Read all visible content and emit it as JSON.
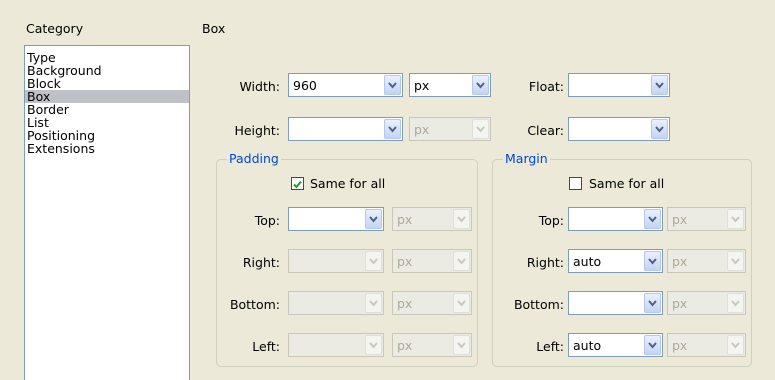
{
  "headers": {
    "category": "Category",
    "box": "Box"
  },
  "categories": [
    "Type",
    "Background",
    "Block",
    "Box",
    "Border",
    "List",
    "Positioning",
    "Extensions"
  ],
  "selected_category": "Box",
  "width": {
    "label": "Width:",
    "value": "960",
    "unit": "px"
  },
  "height": {
    "label": "Height:",
    "value": "",
    "unit": "px"
  },
  "float": {
    "label": "Float:",
    "value": ""
  },
  "clear": {
    "label": "Clear:",
    "value": ""
  },
  "padding": {
    "legend": "Padding",
    "same_for_all": "Same for all",
    "same_checked": true,
    "top": {
      "label": "Top:",
      "value": "",
      "unit": "px"
    },
    "right": {
      "label": "Right:",
      "value": "",
      "unit": "px"
    },
    "bottom": {
      "label": "Bottom:",
      "value": "",
      "unit": "px"
    },
    "left": {
      "label": "Left:",
      "value": "",
      "unit": "px"
    }
  },
  "margin": {
    "legend": "Margin",
    "same_for_all": "Same for all",
    "same_checked": false,
    "top": {
      "label": "Top:",
      "value": "",
      "unit": "px"
    },
    "right": {
      "label": "Right:",
      "value": "auto",
      "unit": "px"
    },
    "bottom": {
      "label": "Bottom:",
      "value": "",
      "unit": "px"
    },
    "left": {
      "label": "Left:",
      "value": "auto",
      "unit": "px"
    }
  }
}
